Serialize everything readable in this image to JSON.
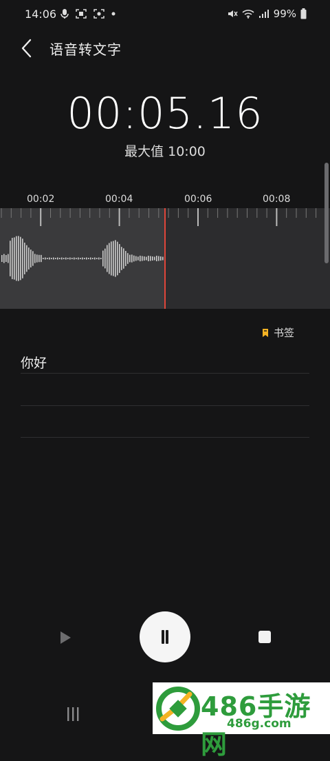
{
  "status_bar": {
    "time": "14:06",
    "battery": "99%"
  },
  "header": {
    "title": "语音转文字"
  },
  "recorder": {
    "timer": "00:05.16",
    "max_label": "最大值 10:00",
    "progress_seconds": 5.16,
    "timeline_labels": [
      "00:02",
      "00:04",
      "00:06",
      "00:08"
    ]
  },
  "bookmark": {
    "label": "书签",
    "icon_color": "#f5b324"
  },
  "transcript": {
    "lines": [
      "你好",
      "",
      ""
    ]
  },
  "controls": {
    "play": "play-icon",
    "pause": "pause-icon",
    "stop": "stop-icon"
  },
  "watermark": {
    "title": "486手游网",
    "url": "486g.com",
    "color": "#2e9c3c"
  },
  "colors": {
    "background": "#151516",
    "playhead": "#e0463a"
  }
}
